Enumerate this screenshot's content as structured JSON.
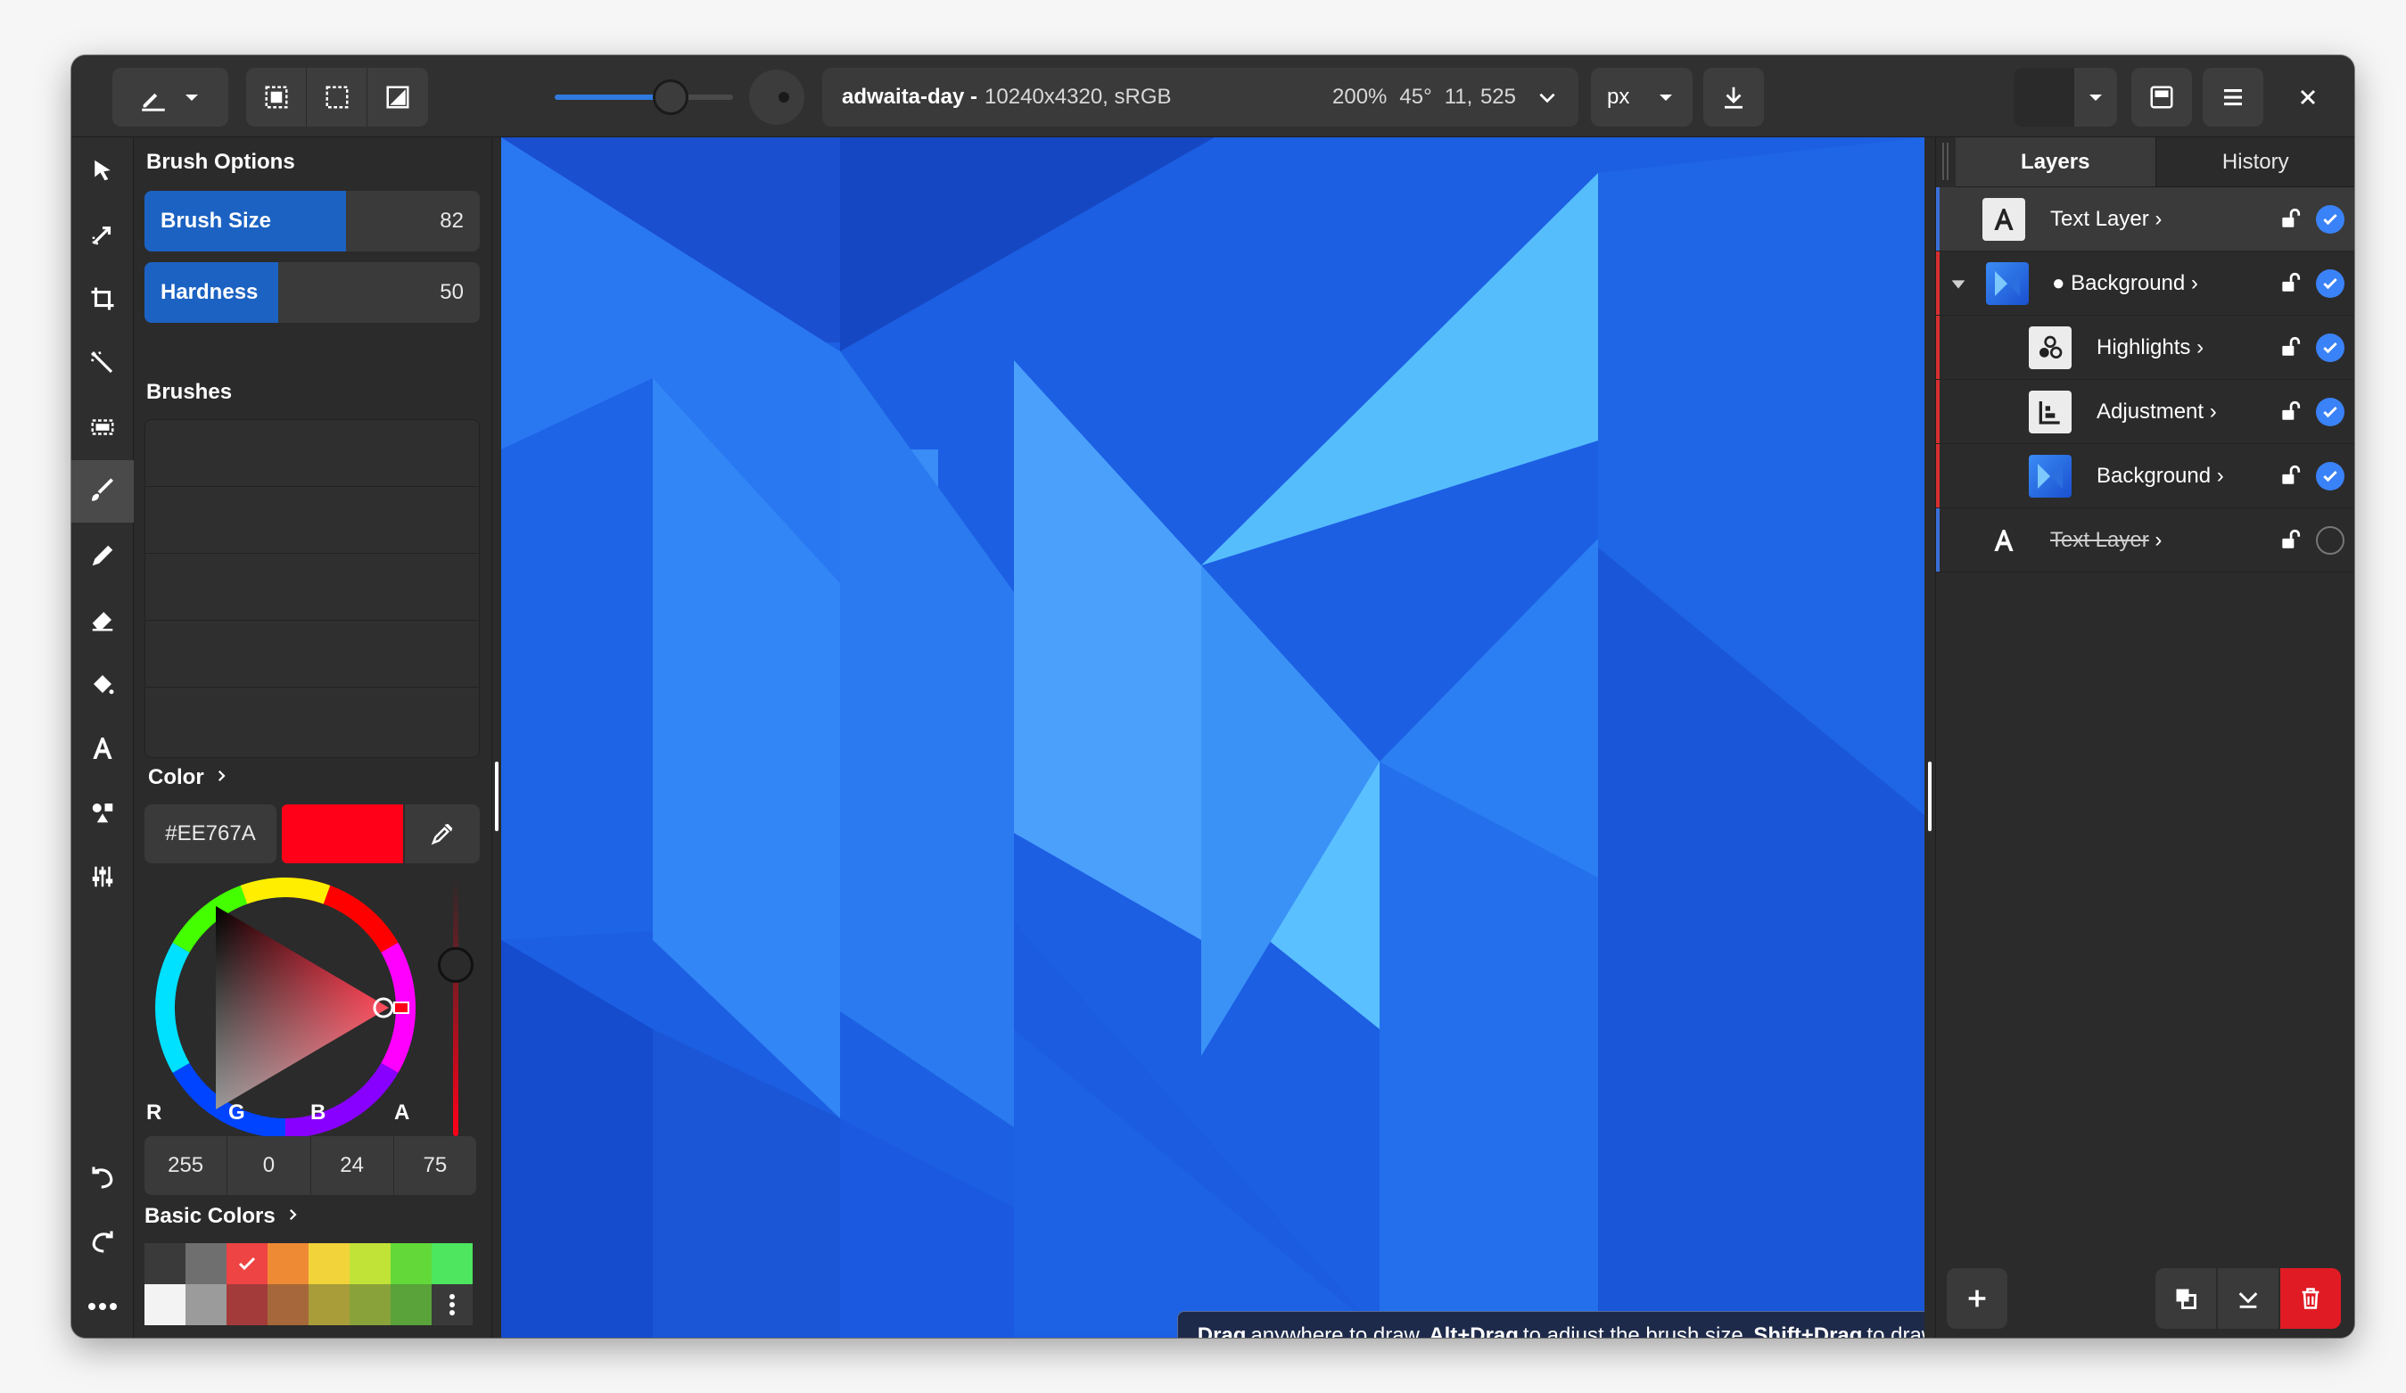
{
  "header": {
    "doc_name": "adwaita-day -",
    "doc_meta": "10240x4320, sRGB",
    "zoom": "200%",
    "rotation": "45°",
    "coords": "11, 525",
    "unit": "px",
    "icons": [
      "brush-tool-icon",
      "chevron-down-icon",
      "select-all-icon",
      "select-none-icon",
      "invert-selection-icon",
      "export-icon",
      "panel-toggle-icon",
      "hamburger-menu-icon",
      "close-icon"
    ],
    "brush_size_slider_fraction": 0.7
  },
  "tools": [
    {
      "name": "pointer-tool",
      "icon": "pointer-icon"
    },
    {
      "name": "move-tool",
      "icon": "move-icon"
    },
    {
      "name": "crop-tool",
      "icon": "crop-icon"
    },
    {
      "name": "magic-wand-tool",
      "icon": "magic-wand-icon"
    },
    {
      "name": "rect-select-tool",
      "icon": "rect-select-icon"
    },
    {
      "name": "brush-tool",
      "icon": "brush-icon"
    },
    {
      "name": "pencil-tool",
      "icon": "pencil-icon"
    },
    {
      "name": "eraser-tool",
      "icon": "eraser-icon"
    },
    {
      "name": "fill-tool",
      "icon": "bucket-icon"
    },
    {
      "name": "text-tool",
      "icon": "text-icon"
    },
    {
      "name": "shapes-tool",
      "icon": "shapes-icon"
    },
    {
      "name": "adjust-tool",
      "icon": "sliders-icon"
    }
  ],
  "brush_options": {
    "title": "Brush Options",
    "size_label": "Brush Size",
    "size_value": "82",
    "size_fraction": 0.6,
    "hardness_label": "Hardness",
    "hardness_value": "50",
    "hardness_fraction": 0.4
  },
  "brushes": {
    "title": "Brushes"
  },
  "color": {
    "title": "Color",
    "hex": "#EE767A",
    "swatch_color": "#ff0018",
    "labels": {
      "r": "R",
      "g": "G",
      "b": "B",
      "a": "A"
    },
    "values": {
      "r": "255",
      "g": "0",
      "b": "24",
      "a": "75"
    }
  },
  "basic_colors": {
    "title": "Basic Colors",
    "row1": [
      "#3a3a3a",
      "#6f6f6f",
      "#ef4444",
      "#ef8a34",
      "#f2d33a",
      "#c1e337",
      "#62d938",
      "#4de65e"
    ],
    "row2": [
      "#f3f3f3",
      "#9b9b9b",
      "#a33b3b",
      "#a6683a",
      "#a99d3a",
      "#8aa23a",
      "#5aa23a",
      "#3a3a3a"
    ]
  },
  "toast": {
    "p1": "Drag",
    "p2": "anywhere to draw.",
    "p3": "Alt+Drag",
    "p4": "to adjust the brush size.",
    "p5": "Shift+Drag",
    "p6": "to draw a straight line."
  },
  "panel_tabs": {
    "layers": "Layers",
    "history": "History"
  },
  "layers": [
    {
      "name": "Text Layer",
      "suffix": "›",
      "visible": true
    },
    {
      "name": "● Background",
      "suffix": "›",
      "visible": true
    },
    {
      "name": "Highlights",
      "suffix": "›",
      "visible": true
    },
    {
      "name": "Adjustment",
      "suffix": "›",
      "visible": true
    },
    {
      "name": "Background",
      "suffix": "›",
      "visible": true
    },
    {
      "name": "Text Layer",
      "suffix": "›",
      "visible": false
    }
  ],
  "colors": {
    "accent": "#1c62c2",
    "group_bar": "#d62f2f",
    "text_bar": "#3a6fd9",
    "delete": "#e01b24"
  }
}
